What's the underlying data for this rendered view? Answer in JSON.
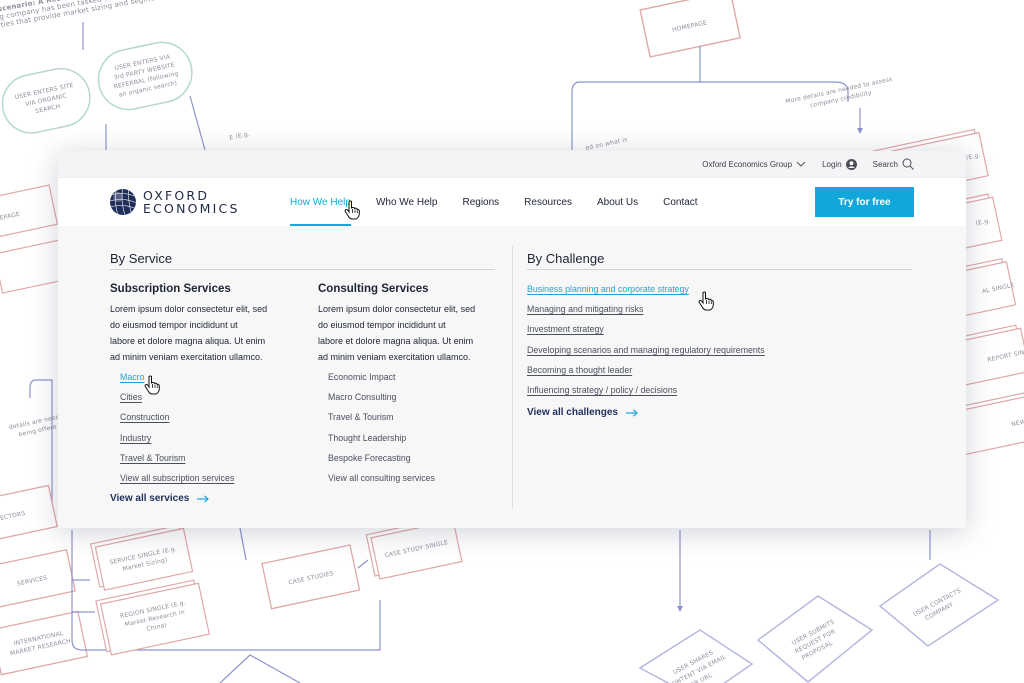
{
  "background": {
    "flowchart_nodes": {
      "intro_text_line1": "scenario: A Research a",
      "intro_text_line2": "g company has been tasked w",
      "intro_text_line3": "ties that provide market sizing and segme",
      "organic_search_1": "USER ENTERS SITE",
      "organic_search_2": "VIA ORGANIC",
      "organic_search_3": "SEARCH",
      "referral_1": "USER ENTERS VIA",
      "referral_2": "3rd PARTY WEBSITE",
      "referral_3": "REFERRAL (following",
      "referral_4": "an organic search)",
      "homepage_top": "HOMEPAGE",
      "more_details_1": "More details are needed to assess",
      "more_details_2": "company credibility",
      "based_on": "ed on what is",
      "homepage_left": "HOMEPAGE",
      "report_single": "REPORT SINGLE",
      "details_needed_1": "details are needed",
      "details_needed_2": "being offere",
      "news_single": "NEWS SING",
      "sectors": "ECTORS",
      "services": "SERVICES",
      "service_single_1": "SERVICE SINGLE (E.g.",
      "service_single_2": "Market Sizing)",
      "case_studies": "CASE STUDIES",
      "case_study_single": "CASE STUDY SINGLE",
      "region_single_1": "REGION SINGLE (E.g.",
      "region_single_2": "Market Research in",
      "region_single_3": "China)",
      "international_1": "INTERNATIONAL",
      "international_2": "MARKET RESEARCH",
      "user_contacts_1": "USER CONTACTS",
      "user_contacts_2": "COMPANY",
      "user_submits_1": "USER SUBMITS",
      "user_submits_2": "REQUEST FOR",
      "user_submits_3": "PROPOSAL",
      "user_shares_1": "USER SHARES",
      "user_shares_2": "CONTENT VIA EMAIL",
      "user_shares_3": "OR URL",
      "eg_1": "E (E.g.",
      "eg_2": "(E.g.",
      "eg_3": "E (E.g.",
      "al_single": "AL SINGLE",
      "regi": "REGI",
      "me": "M"
    }
  },
  "utility_bar": {
    "group_link": "Oxford Economics Group",
    "login": "Login",
    "search": "Search"
  },
  "logo": {
    "line1": "OXFORD",
    "line2": "ECONOMICS"
  },
  "main_nav": {
    "items": [
      "How We Help",
      "Who We Help",
      "Regions",
      "Resources",
      "About Us",
      "Contact"
    ],
    "cta": "Try for free"
  },
  "mega_menu": {
    "by_service": {
      "title": "By Service",
      "subscription": {
        "title": "Subscription Services",
        "description_lines": [
          "Lorem ipsum dolor consectetur elit, sed",
          "do eiusmod tempor incididunt ut",
          "labore et dolore magna aliqua. Ut enim",
          "ad minim veniam exercitation ullamco."
        ],
        "links": [
          "Macro",
          "Cities",
          "Construction",
          "Industry",
          "Travel & Tourism",
          "View all subscription services"
        ]
      },
      "consulting": {
        "title": "Consulting Services",
        "description_lines": [
          "Lorem ipsum dolor consectetur elit, sed",
          "do eiusmod tempor incididunt ut",
          "labore et dolore magna aliqua. Ut enim",
          "ad minim veniam exercitation ullamco."
        ],
        "links": [
          "Economic Impact",
          "Macro Consulting",
          "Travel & Tourism",
          "Thought Leadership",
          "Bespoke Forecasting",
          "View all consulting services"
        ]
      },
      "view_all": "View all services"
    },
    "by_challenge": {
      "title": "By Challenge",
      "links": [
        "Business planning and corporate strategy",
        "Managing and mitigating risks",
        "Investment strategy",
        "Developing scenarios and managing regulatory requirements",
        "Becoming a thought leader",
        "Influencing strategy / policy / decisions"
      ],
      "view_all": "View all challenges"
    }
  },
  "colors": {
    "accent": "#1aa6d9",
    "cta_bg": "#12a7db",
    "heading": "#1d2433",
    "view_all": "#1f2f5a",
    "flow_line": "#8e93d0",
    "node_red": "#e0a9a9",
    "node_green": "#b6d9c7"
  },
  "icons": [
    "chevron-down-icon",
    "user-icon",
    "search-icon",
    "globe-logo-icon",
    "arrow-right-icon",
    "hand-cursor-icon"
  ]
}
